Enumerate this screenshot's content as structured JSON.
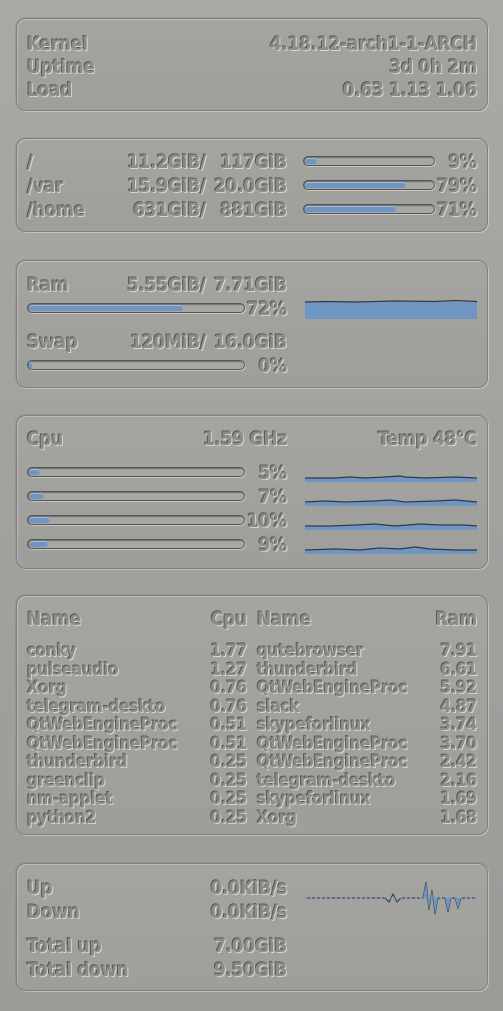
{
  "system": {
    "kernel_label": "Kernel",
    "kernel_value": "4.18.12-arch1-1-ARCH",
    "uptime_label": "Uptime",
    "uptime_value": "3d 0h 2m",
    "load_label": "Load",
    "load_value": "0.63 1.13 1.06"
  },
  "disks": [
    {
      "mount": "/",
      "used": "11.2GiB/",
      "total": "117GiB",
      "percent": 9,
      "percent_label": "9%"
    },
    {
      "mount": "/var",
      "used": "15.9GiB/",
      "total": "20.0GiB",
      "percent": 79,
      "percent_label": "79%"
    },
    {
      "mount": "/home",
      "used": "631GiB/",
      "total": "881GiB",
      "percent": 71,
      "percent_label": "71%"
    }
  ],
  "memory": {
    "ram_label": "Ram",
    "ram_used": "5.55GiB/",
    "ram_total": "7.71GiB",
    "ram_percent": 72,
    "ram_percent_label": "72%",
    "swap_label": "Swap",
    "swap_used": "120MiB/",
    "swap_total": "16.0GiB",
    "swap_percent": 0,
    "swap_percent_label": "0%"
  },
  "cpu": {
    "label": "Cpu",
    "freq": "1.59 GHz",
    "temp": "Temp 48°C",
    "cores": [
      {
        "percent": 5,
        "label": "5%"
      },
      {
        "percent": 7,
        "label": "7%"
      },
      {
        "percent": 10,
        "label": "10%"
      },
      {
        "percent": 9,
        "label": "9%"
      }
    ]
  },
  "processes": {
    "cpu_header_name": "Name",
    "cpu_header_value": "Cpu",
    "ram_header_name": "Name",
    "ram_header_value": "Ram",
    "by_cpu": [
      {
        "name": "conky",
        "value": "1.77"
      },
      {
        "name": "pulseaudio",
        "value": "1.27"
      },
      {
        "name": "Xorg",
        "value": "0.76"
      },
      {
        "name": "telegram-deskto",
        "value": "0.76"
      },
      {
        "name": "QtWebEngineProc",
        "value": "0.51"
      },
      {
        "name": "QtWebEngineProc",
        "value": "0.51"
      },
      {
        "name": "thunderbird",
        "value": "0.25"
      },
      {
        "name": "greenclip",
        "value": "0.25"
      },
      {
        "name": "nm-applet",
        "value": "0.25"
      },
      {
        "name": "python2",
        "value": "0.25"
      }
    ],
    "by_ram": [
      {
        "name": "qutebrowser",
        "value": "7.91"
      },
      {
        "name": "thunderbird",
        "value": "6.61"
      },
      {
        "name": "QtWebEngineProc",
        "value": "5.92"
      },
      {
        "name": "slack",
        "value": "4.87"
      },
      {
        "name": "skypeforlinux",
        "value": "3.74"
      },
      {
        "name": "QtWebEngineProc",
        "value": "3.70"
      },
      {
        "name": "QtWebEngineProc",
        "value": "2.42"
      },
      {
        "name": "telegram-deskto",
        "value": "2.16"
      },
      {
        "name": "skypeforlinux",
        "value": "1.69"
      },
      {
        "name": "Xorg",
        "value": "1.68"
      }
    ]
  },
  "network": {
    "up_label": "Up",
    "up_value": "0.0KiB/s",
    "down_label": "Down",
    "down_value": "0.0KiB/s",
    "total_up_label": "Total up",
    "total_up_value": "7.00GiB",
    "total_down_label": "Total down",
    "total_down_value": "9.50GiB"
  },
  "colors": {
    "accent": "#6f96c2",
    "text": "#8c8c89",
    "background": "#a3a3a0"
  }
}
